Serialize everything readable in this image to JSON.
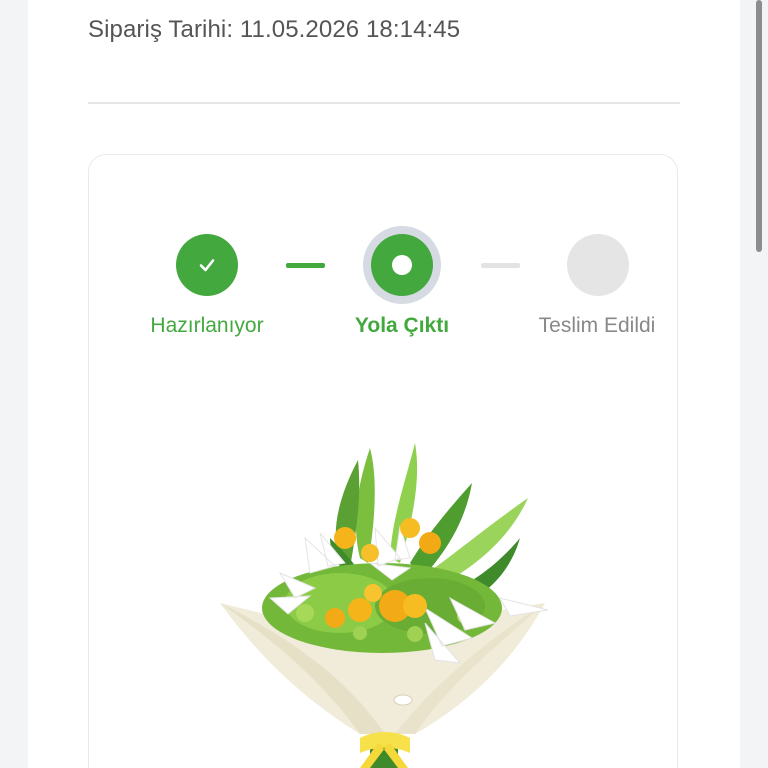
{
  "order": {
    "date_text": "Sipariş Tarihi: 11.05.2026 18:14:45"
  },
  "tracking": {
    "steps": [
      {
        "label": "Hazırlanıyor",
        "status": "completed",
        "icon": "check-icon"
      },
      {
        "label": "Yola Çıktı",
        "status": "current",
        "icon": "dot-icon"
      },
      {
        "label": "Teslim Edildi",
        "status": "pending",
        "icon": ""
      }
    ]
  },
  "product": {
    "image_icon": "bouquet-icon"
  },
  "colors": {
    "accent": "#43a93f",
    "inactive": "#e5e5e5",
    "text_muted": "#888888",
    "text_primary": "#555555"
  }
}
